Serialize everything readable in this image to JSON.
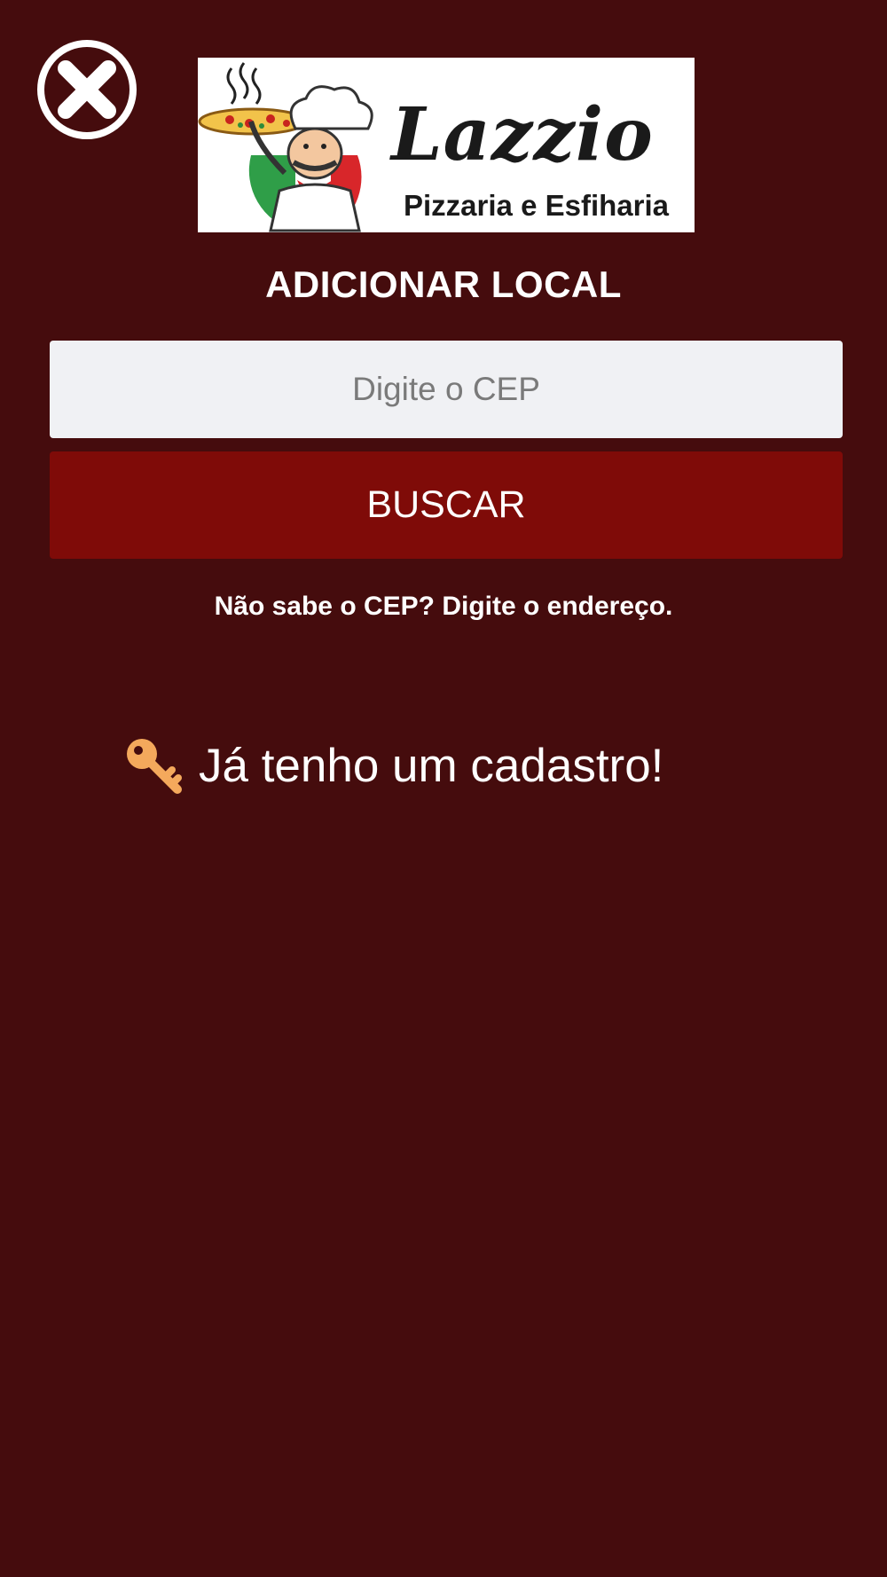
{
  "close": {
    "icon": "close-circle-icon"
  },
  "logo": {
    "brand": "Lazzio",
    "subtitle": "Pizzaria e Esfiharia",
    "mascot_icon": "chef-with-pizza-icon"
  },
  "title": "ADICIONAR LOCAL",
  "cep_input": {
    "placeholder": "Digite o CEP",
    "value": ""
  },
  "search_button": {
    "label": "BUSCAR"
  },
  "address_link": "Não sabe o CEP? Digite o endereço.",
  "login_link": {
    "icon": "key-icon",
    "label": "Já tenho um cadastro!"
  },
  "colors": {
    "background": "#450c0d",
    "button": "#7f0b08",
    "input_bg": "#f0f1f4",
    "key": "#f4a95c"
  }
}
